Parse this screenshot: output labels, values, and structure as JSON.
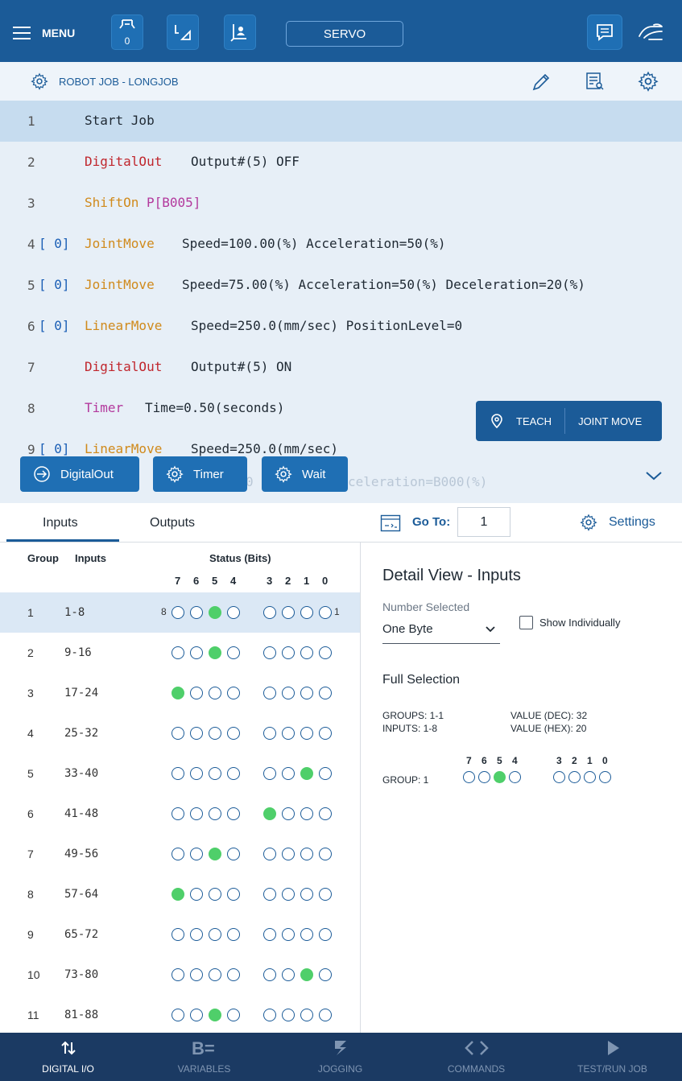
{
  "topbar": {
    "menu_label": "MENU",
    "tool_counter": "0",
    "servo_label": "SERVO",
    "icons": [
      "menu-icon",
      "gripper-icon",
      "coordinate-frame-icon",
      "user-frame-icon",
      "message-icon",
      "hand-icon"
    ]
  },
  "job": {
    "title": "ROBOT JOB - LONGJOB"
  },
  "code": {
    "lines": [
      {
        "num": "1",
        "kw": "Start Job",
        "args": ""
      },
      {
        "num": "2",
        "kw": "DigitalOut",
        "args": "Output#(5)  OFF"
      },
      {
        "num": "3",
        "kw": "ShiftOn",
        "args": "P[B005]"
      },
      {
        "num": "4",
        "bracket": "[ 0]",
        "kw": "JointMove",
        "args": "Speed=100.00(%)  Acceleration=50(%)"
      },
      {
        "num": "5",
        "bracket": "[ 0]",
        "kw": "JointMove",
        "args": "Speed=75.00(%)  Acceleration=50(%)  Deceleration=20(%)"
      },
      {
        "num": "6",
        "bracket": "[ 0]",
        "kw": "LinearMove",
        "args": "Speed=250.0(mm/sec)  PositionLevel=0"
      },
      {
        "num": "7",
        "kw": "DigitalOut",
        "args": "Output#(5)  ON"
      },
      {
        "num": "8",
        "kw": "Timer",
        "args": "Time=0.50(seconds)"
      },
      {
        "num": "9",
        "bracket": "[ 0]",
        "kw": "LinearMove",
        "args": "Speed=250.0(mm/sec)"
      }
    ],
    "ghost_fragment_left": "0",
    "ghost_fragment_right": "celeration=B000(%)",
    "teach_label": "TEACH",
    "joint_move_label": "JOINT MOVE",
    "quick_buttons": [
      "DigitalOut",
      "Timer",
      "Wait"
    ]
  },
  "io": {
    "tabs": [
      "Inputs",
      "Outputs"
    ],
    "goto_label": "Go To:",
    "goto_value": "1",
    "settings_label": "Settings"
  },
  "table": {
    "col_group": "Group",
    "col_inputs": "Inputs",
    "col_status": "Status (Bits)",
    "bit_labels_high": [
      "7",
      "6",
      "5",
      "4"
    ],
    "bit_labels_low": [
      "3",
      "2",
      "1",
      "0"
    ],
    "edge_left": "8",
    "edge_right": "1",
    "rows": [
      {
        "group": "1",
        "range": "1-8",
        "bits": [
          0,
          0,
          1,
          0,
          0,
          0,
          0,
          0
        ]
      },
      {
        "group": "2",
        "range": "9-16",
        "bits": [
          0,
          0,
          1,
          0,
          0,
          0,
          0,
          0
        ]
      },
      {
        "group": "3",
        "range": "17-24",
        "bits": [
          1,
          0,
          0,
          0,
          0,
          0,
          0,
          0
        ]
      },
      {
        "group": "4",
        "range": "25-32",
        "bits": [
          0,
          0,
          0,
          0,
          0,
          0,
          0,
          0
        ]
      },
      {
        "group": "5",
        "range": "33-40",
        "bits": [
          0,
          0,
          0,
          0,
          0,
          0,
          1,
          0
        ]
      },
      {
        "group": "6",
        "range": "41-48",
        "bits": [
          0,
          0,
          0,
          0,
          1,
          0,
          0,
          0
        ]
      },
      {
        "group": "7",
        "range": "49-56",
        "bits": [
          0,
          0,
          1,
          0,
          0,
          0,
          0,
          0
        ]
      },
      {
        "group": "8",
        "range": "57-64",
        "bits": [
          1,
          0,
          0,
          0,
          0,
          0,
          0,
          0
        ]
      },
      {
        "group": "9",
        "range": "65-72",
        "bits": [
          0,
          0,
          0,
          0,
          0,
          0,
          0,
          0
        ]
      },
      {
        "group": "10",
        "range": "73-80",
        "bits": [
          0,
          0,
          0,
          0,
          0,
          0,
          1,
          0
        ]
      },
      {
        "group": "11",
        "range": "81-88",
        "bits": [
          0,
          0,
          1,
          0,
          0,
          0,
          0,
          0
        ]
      }
    ]
  },
  "detail": {
    "title": "Detail View - Inputs",
    "number_selected_label": "Number Selected",
    "number_selected_value": "One Byte",
    "show_individually": "Show Individually",
    "full_selection": "Full Selection",
    "groups": "GROUPS: 1-1",
    "inputs": "INPUTS:  1-8",
    "value_dec": "VALUE (DEC): 32",
    "value_hex": "VALUE (HEX): 20",
    "group_label": "GROUP: 1",
    "bit_labels_high": [
      "7",
      "6",
      "5",
      "4"
    ],
    "bit_labels_low": [
      "3",
      "2",
      "1",
      "0"
    ],
    "bits": [
      0,
      0,
      1,
      0,
      0,
      0,
      0,
      0
    ]
  },
  "bottomnav": {
    "items": [
      {
        "label": "DIGITAL I/O",
        "icon": "digital-io-icon",
        "active": true
      },
      {
        "label": "VARIABLES",
        "icon": "variables-icon",
        "active": false
      },
      {
        "label": "JOGGING",
        "icon": "jogging-icon",
        "active": false
      },
      {
        "label": "COMMANDS",
        "icon": "commands-icon",
        "active": false
      },
      {
        "label": "TEST/RUN JOB",
        "icon": "test-run-icon",
        "active": false
      }
    ]
  },
  "colors": {
    "primary": "#1b5b98",
    "bit_on": "#4fcf6a",
    "nav_bg": "#1b3a63",
    "selected_row": "#dbe8f5"
  }
}
